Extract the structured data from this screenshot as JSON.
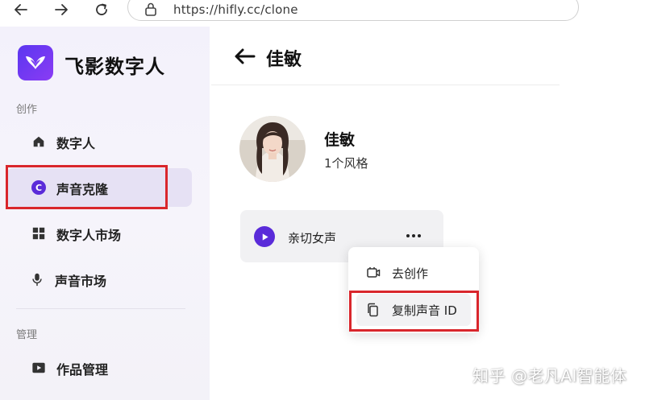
{
  "browser": {
    "url": "https://hifly.cc/clone"
  },
  "sidebar": {
    "brand": "飞影数字人",
    "sections": [
      {
        "label": "创作"
      },
      {
        "label": "管理"
      }
    ],
    "items": [
      {
        "label": "数字人",
        "icon": "home-icon",
        "active": false
      },
      {
        "label": "声音克隆",
        "icon": "voice-clone-icon",
        "active": true
      },
      {
        "label": "数字人市场",
        "icon": "grid-icon",
        "active": false
      },
      {
        "label": "声音市场",
        "icon": "microphone-icon",
        "active": false
      },
      {
        "label": "作品管理",
        "icon": "video-icon",
        "active": false
      }
    ],
    "active_icon_letter": "C"
  },
  "page": {
    "title": "佳敏"
  },
  "profile": {
    "name": "佳敏",
    "subtitle": "1个风格"
  },
  "voice_card": {
    "name": "亲切女声"
  },
  "context_menu": {
    "items": [
      {
        "label": "去创作",
        "icon": "create-icon"
      },
      {
        "label": "复制声音 ID",
        "icon": "copy-icon"
      }
    ]
  },
  "watermark": "知乎 @老凡AI智能体",
  "colors": {
    "accent": "#5a2bd9",
    "highlight": "#d9262c",
    "active_bg": "#e6e1f4"
  }
}
